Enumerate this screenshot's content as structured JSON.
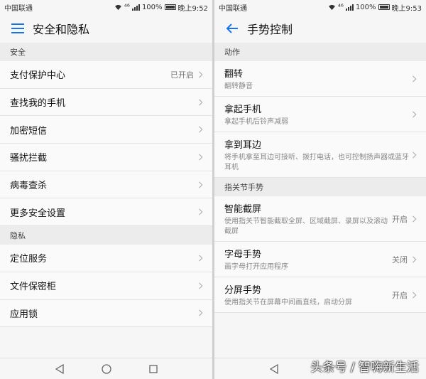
{
  "left": {
    "status": {
      "carrier": "中国联通",
      "signal_tag": "⁴⁶",
      "battery": "100%",
      "time": "晚上9:52"
    },
    "title": "安全和隐私",
    "sections": [
      {
        "header": "安全",
        "items": [
          {
            "label": "支付保护中心",
            "value": "已开启"
          },
          {
            "label": "查找我的手机",
            "value": ""
          },
          {
            "label": "加密短信",
            "value": ""
          },
          {
            "label": "骚扰拦截",
            "value": ""
          },
          {
            "label": "病毒查杀",
            "value": ""
          },
          {
            "label": "更多安全设置",
            "value": ""
          }
        ]
      },
      {
        "header": "隐私",
        "items": [
          {
            "label": "定位服务",
            "value": ""
          },
          {
            "label": "文件保密柜",
            "value": ""
          },
          {
            "label": "应用锁",
            "value": ""
          }
        ]
      }
    ]
  },
  "right": {
    "status": {
      "carrier": "中国联通",
      "signal_tag": "⁴⁶",
      "battery": "100%",
      "time": "晚上9:53"
    },
    "title": "手势控制",
    "sections": [
      {
        "header": "动作",
        "items": [
          {
            "label": "翻转",
            "sub": "翻转静音",
            "value": ""
          },
          {
            "label": "拿起手机",
            "sub": "拿起手机后铃声减弱",
            "value": ""
          },
          {
            "label": "拿到耳边",
            "sub": "将手机拿至耳边可接听、拨打电话，也可控制扬声器或蓝牙耳机",
            "value": ""
          }
        ]
      },
      {
        "header": "指关节手势",
        "items": [
          {
            "label": "智能截屏",
            "sub": "使用指关节智能截取全屏、区域截屏、录屏以及滚动截屏",
            "value": "开启"
          },
          {
            "label": "字母手势",
            "sub": "画字母打开应用程序",
            "value": "关闭"
          },
          {
            "label": "分屏手势",
            "sub": "使用指关节在屏幕中间画直线，启动分屏",
            "value": "开启"
          }
        ]
      }
    ]
  },
  "watermark": "头条号 / 智嗨新生活",
  "colors": {
    "accent": "#1a73e8",
    "background": "#f6f6f6",
    "section": "#ececec"
  },
  "icons": {
    "left_nav": "hamburger-menu-icon",
    "right_nav": "back-arrow-icon"
  }
}
